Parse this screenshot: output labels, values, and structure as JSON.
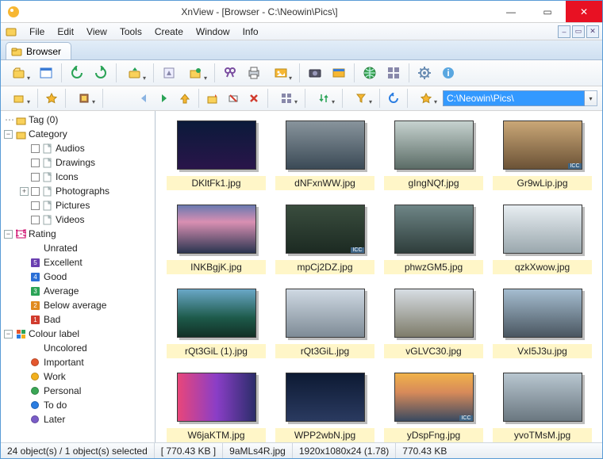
{
  "window": {
    "title": "XnView - [Browser - C:\\Neowin\\Pics\\]"
  },
  "menu": {
    "items": [
      "File",
      "Edit",
      "View",
      "Tools",
      "Create",
      "Window",
      "Info"
    ]
  },
  "tab": {
    "label": "Browser"
  },
  "path": {
    "value": "C:\\Neowin\\Pics\\"
  },
  "sidebar": {
    "tag_label": "Tag (0)",
    "category_label": "Category",
    "categories": [
      "Audios",
      "Drawings",
      "Icons",
      "Photographs",
      "Pictures",
      "Videos"
    ],
    "rating_label": "Rating",
    "ratings": [
      {
        "label": "Unrated",
        "n": "",
        "bg": "transparent"
      },
      {
        "label": "Excellent",
        "n": "5",
        "bg": "#6a3fb0"
      },
      {
        "label": "Good",
        "n": "4",
        "bg": "#2a6fd6"
      },
      {
        "label": "Average",
        "n": "3",
        "bg": "#2aa356"
      },
      {
        "label": "Below average",
        "n": "2",
        "bg": "#e08a1e"
      },
      {
        "label": "Bad",
        "n": "1",
        "bg": "#d13c2e"
      }
    ],
    "colour_label": "Colour label",
    "colours": [
      {
        "label": "Uncolored",
        "c": "transparent"
      },
      {
        "label": "Important",
        "c": "#e4572e"
      },
      {
        "label": "Work",
        "c": "#f2b01e"
      },
      {
        "label": "Personal",
        "c": "#3aa655"
      },
      {
        "label": "To do",
        "c": "#2a7de1"
      },
      {
        "label": "Later",
        "c": "#7a5cc7"
      }
    ]
  },
  "thumbs": [
    {
      "name": "DKltFk1.jpg",
      "bg": "linear-gradient(#0b1a3a,#29154a)",
      "icc": false
    },
    {
      "name": "dNFxnWW.jpg",
      "bg": "linear-gradient(#88949c,#3b4a56)",
      "icc": false
    },
    {
      "name": "gIngNQf.jpg",
      "bg": "linear-gradient(#c6d2cf,#5b6c66)",
      "icc": false
    },
    {
      "name": "Gr9wLip.jpg",
      "bg": "linear-gradient(#caa777,#6b5236)",
      "icc": true
    },
    {
      "name": "INKBgjK.jpg",
      "bg": "linear-gradient(#6a79b0 0%,#d98fb2 35%,#2b3550 100%)",
      "icc": false
    },
    {
      "name": "mpCj2DZ.jpg",
      "bg": "linear-gradient(#3a4d3e,#1c2a22)",
      "icc": true
    },
    {
      "name": "phwzGM5.jpg",
      "bg": "linear-gradient(#6e8586,#2e3d3b)",
      "icc": false
    },
    {
      "name": "qzkXwow.jpg",
      "bg": "linear-gradient(#e8eef2,#9aa7ad)",
      "icc": false
    },
    {
      "name": "rQt3GiL (1).jpg",
      "bg": "linear-gradient(#6aa7c7 0%,#1d5a4a 60%,#123026 100%)",
      "icc": false
    },
    {
      "name": "rQt3GiL.jpg",
      "bg": "linear-gradient(#cfd9e3,#7e8b96)",
      "icc": false
    },
    {
      "name": "vGLVC30.jpg",
      "bg": "linear-gradient(#d7dde3,#7e7c6a)",
      "icc": false
    },
    {
      "name": "VxI5J3u.jpg",
      "bg": "linear-gradient(#a5bdd0,#4a5660)",
      "icc": false
    },
    {
      "name": "W6jaKTM.jpg",
      "bg": "linear-gradient(90deg,#e8467a,#8a3ec7,#2b2d6a)",
      "icc": false
    },
    {
      "name": "WPP2wbN.jpg",
      "bg": "linear-gradient(#0d1a33,#2a3a60)",
      "icc": false
    },
    {
      "name": "yDspFng.jpg",
      "bg": "linear-gradient(#f0b24a 0%,#d78a5a 40%,#3a4a60 100%)",
      "icc": true
    },
    {
      "name": "yvoTMsM.jpg",
      "bg": "linear-gradient(#b8c6d0,#6a7780)",
      "icc": false
    }
  ],
  "status": {
    "objects": "24 object(s) / 1 object(s) selected",
    "size_sel": "[ 770.43 KB ]",
    "filename": "9aMLs4R.jpg",
    "dims": "1920x1080x24 (1.78)",
    "size_file": "770.43 KB"
  },
  "icons": {
    "minimize": "—",
    "maximize": "▭",
    "close": "✕",
    "dropdown": "▾"
  }
}
